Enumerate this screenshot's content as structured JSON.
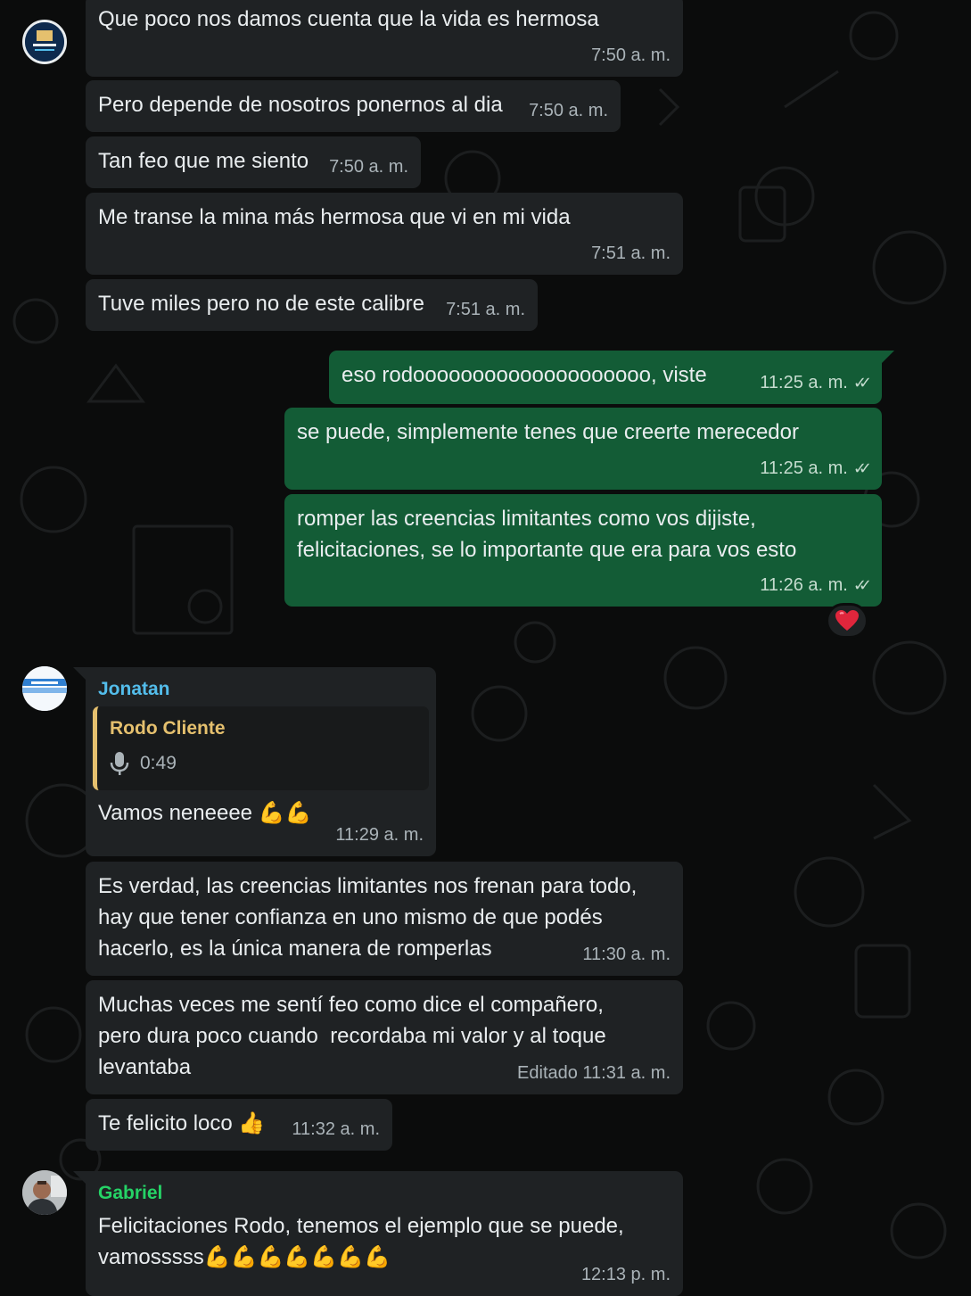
{
  "messages": {
    "m1": {
      "text": "Que poco nos damos cuenta que la vida es hermosa",
      "time": "7:50 a. m."
    },
    "m2": {
      "text": "Pero depende de nosotros ponernos al dia",
      "time": "7:50 a. m."
    },
    "m3": {
      "text": "Tan feo que me siento",
      "time": "7:50 a. m."
    },
    "m4": {
      "text": "Me transe la mina más hermosa que vi en mi vida",
      "time": "7:51 a. m."
    },
    "m5": {
      "text": "Tuve miles pero no de este calibre",
      "time": "7:51 a. m."
    },
    "m6": {
      "text": "eso rodoooooooooooooooooooo, viste",
      "time": "11:25 a. m.",
      "status": "read"
    },
    "m7": {
      "text": "se puede, simplemente tenes que creerte merecedor",
      "time": "11:25 a. m.",
      "status": "read"
    },
    "m8": {
      "text": "romper las creencias limitantes como vos dijiste,\nfelicitaciones, se lo importante que era para vos esto",
      "time": "11:26 a. m.",
      "status": "read",
      "reaction": "❤️"
    },
    "m9": {
      "sender": "Jonatan",
      "sender_color": "#53bdeb",
      "quote": {
        "author": "Rodo Cliente",
        "icon": "mic-icon",
        "duration": "0:49"
      },
      "text": "Vamos neneeee ",
      "emoji": "💪💪",
      "time": "11:29 a. m."
    },
    "m10": {
      "text": "Es verdad, las creencias limitantes nos frenan para todo,\nhay que tener confianza en uno mismo de que podés\nhacerlo, es la única manera de romperlas",
      "time": "11:30 a. m."
    },
    "m11": {
      "text": "Muchas veces me sentí feo como dice el compañero,\npero dura poco cuando  recordaba mi valor y al toque\nlevantaba",
      "time": "Editado 11:31 a. m."
    },
    "m12": {
      "text": "Te felicito loco ",
      "emoji": "👍",
      "time": "11:32 a. m."
    },
    "m13": {
      "sender": "Gabriel",
      "sender_color": "#25d366",
      "text": "Felicitaciones Rodo, tenemos el ejemplo que se puede,\nvamosssss",
      "emoji": "💪💪💪💪💪💪💪",
      "time": "12:13 p. m."
    }
  },
  "colors": {
    "incoming": "#1f2224",
    "outgoing": "#135c36",
    "background": "#0b0c0c",
    "quote_accent": "#e5c06e"
  }
}
